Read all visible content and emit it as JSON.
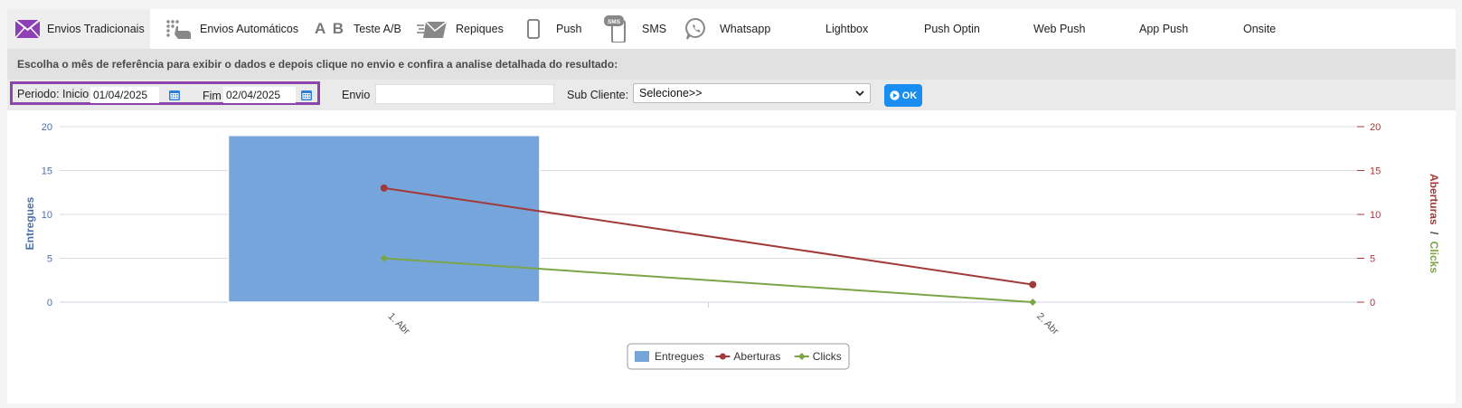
{
  "tabs": [
    {
      "label": "Envios Tradicionais",
      "icon": "envelope-icon",
      "active": true
    },
    {
      "label": "Envios Automáticos",
      "icon": "hand-tap-icon",
      "active": false
    },
    {
      "label": "Teste A/B",
      "icon": "ab-test-icon",
      "active": false
    },
    {
      "label": "Repiques",
      "icon": "resend-envelope-icon",
      "active": false
    },
    {
      "label": "Push",
      "icon": "phone-icon",
      "active": false
    },
    {
      "label": "SMS",
      "icon": "sms-phone-icon",
      "active": false
    },
    {
      "label": "Whatsapp",
      "icon": "whatsapp-icon",
      "active": false
    },
    {
      "label": "Lightbox",
      "icon": "",
      "active": false
    },
    {
      "label": "Push Optin",
      "icon": "",
      "active": false
    },
    {
      "label": "Web Push",
      "icon": "",
      "active": false
    },
    {
      "label": "App Push",
      "icon": "",
      "active": false
    },
    {
      "label": "Onsite",
      "icon": "",
      "active": false
    }
  ],
  "info": {
    "text": "Escolha o mês de referência para exibir o dados e depois clique no envio e confira a analise detalhada do resultado:"
  },
  "filters": {
    "periodo_label": "Periodo: Inicio",
    "inicio_value": "01/04/2025",
    "fim_label": "Fim",
    "fim_value": "02/04/2025",
    "envio_label": "Envio",
    "envio_value": "",
    "subcliente_label": "Sub Cliente:",
    "subcliente_selected": "Selecione>>",
    "ok_label": "OK"
  },
  "colors": {
    "accent": "#1a8ef0",
    "periodo_border": "#8e44ad",
    "entregues": "#76a5db",
    "aberturas": "#a23a3a",
    "clicks": "#7ca548"
  },
  "chart_data": {
    "type": "bar",
    "categories": [
      "1. Abr",
      "2. Abr"
    ],
    "ylabel_left": "Entregues",
    "ylabel_right_parts": [
      "Aberturas",
      "/",
      "Clicks"
    ],
    "ylim_left": [
      0,
      20
    ],
    "ylim_right": [
      0,
      20
    ],
    "yticks": [
      0,
      5,
      10,
      15,
      20
    ],
    "legend_position": "bottom-center",
    "grid": true,
    "series": [
      {
        "name": "Entregues",
        "kind": "bar",
        "axis": "left",
        "values": [
          19,
          0
        ]
      },
      {
        "name": "Aberturas",
        "kind": "line",
        "axis": "right",
        "values": [
          13,
          2
        ]
      },
      {
        "name": "Clicks",
        "kind": "line",
        "axis": "right",
        "values": [
          5,
          0
        ]
      }
    ]
  }
}
